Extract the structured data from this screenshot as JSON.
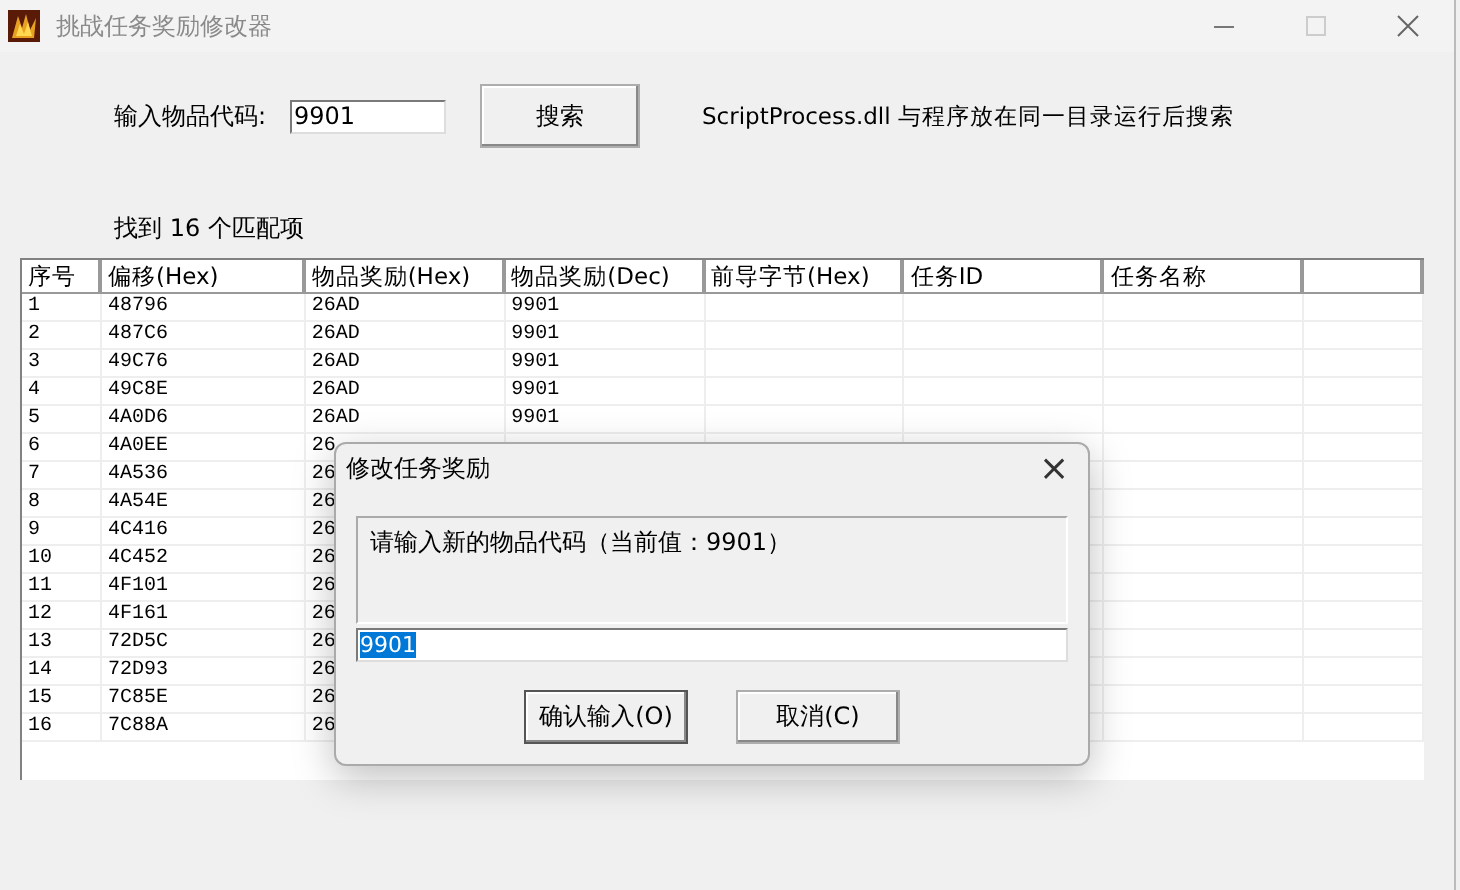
{
  "window": {
    "title": "挑战任务奖励修改器"
  },
  "search": {
    "label": "输入物品代码:",
    "value": "9901",
    "button": "搜索",
    "hint": "ScriptProcess.dll 与程序放在同一目录运行后搜索"
  },
  "result_count": "找到 16 个匹配项",
  "table": {
    "columns": [
      "序号",
      "偏移(Hex)",
      "物品奖励(Hex)",
      "物品奖励(Dec)",
      "前导字节(Hex)",
      "任务ID",
      "任务名称"
    ],
    "rows": [
      [
        "1",
        "48796",
        "26AD",
        "9901"
      ],
      [
        "2",
        "487C6",
        "26AD",
        "9901"
      ],
      [
        "3",
        "49C76",
        "26AD",
        "9901"
      ],
      [
        "4",
        "49C8E",
        "26AD",
        "9901"
      ],
      [
        "5",
        "4A0D6",
        "26AD",
        "9901"
      ],
      [
        "6",
        "4A0EE",
        "26"
      ],
      [
        "7",
        "4A536",
        "26"
      ],
      [
        "8",
        "4A54E",
        "26"
      ],
      [
        "9",
        "4C416",
        "26"
      ],
      [
        "10",
        "4C452",
        "26"
      ],
      [
        "11",
        "4F101",
        "26"
      ],
      [
        "12",
        "4F161",
        "26"
      ],
      [
        "13",
        "72D5C",
        "26"
      ],
      [
        "14",
        "72D93",
        "26"
      ],
      [
        "15",
        "7C85E",
        "26"
      ],
      [
        "16",
        "7C88A",
        "26"
      ]
    ]
  },
  "dialog": {
    "title": "修改任务奖励",
    "close": "×",
    "message": "请输入新的物品代码（当前值：9901）",
    "value": "9901",
    "value_selected": true,
    "buttons": [
      "确认输入(O)",
      "取消(C)"
    ]
  }
}
